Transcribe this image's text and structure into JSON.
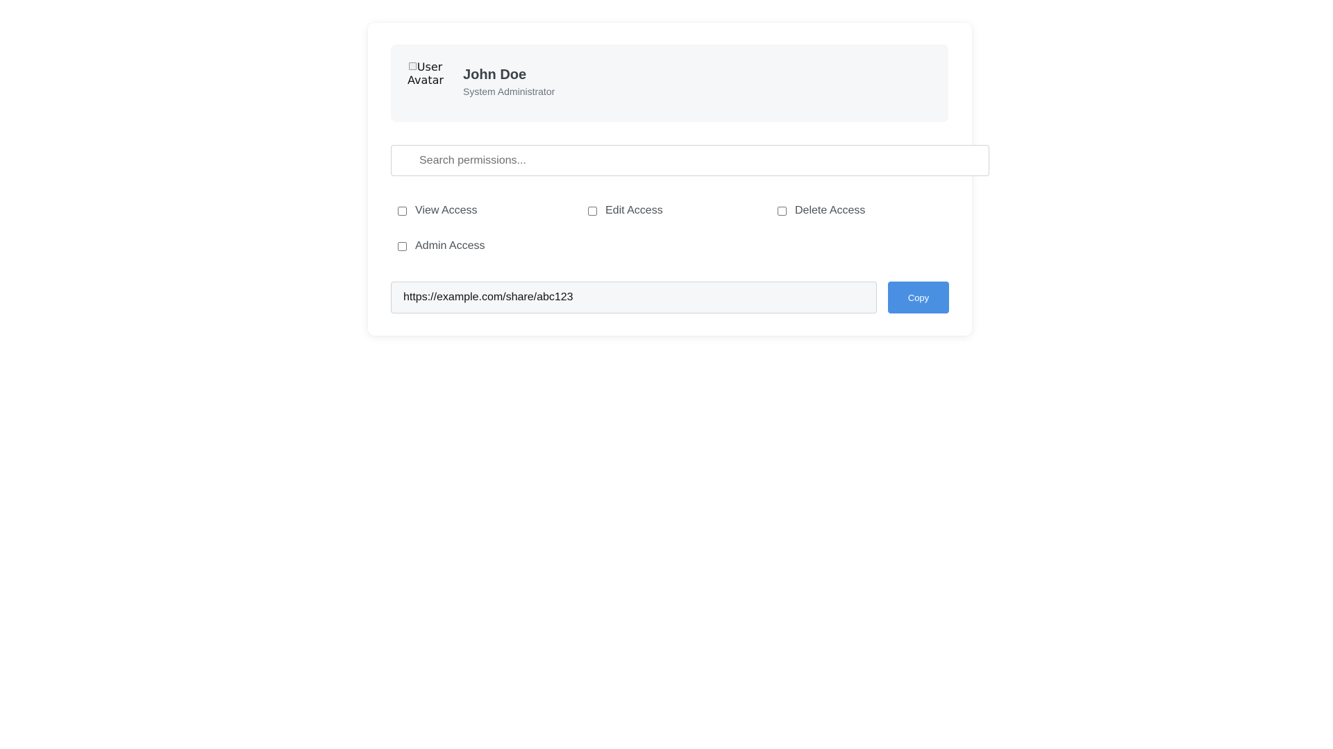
{
  "profile": {
    "avatar_alt": "User Avatar",
    "name": "John Doe",
    "role": "System Administrator"
  },
  "search": {
    "placeholder": "Search permissions...",
    "value": ""
  },
  "permissions": [
    {
      "label": "View Access",
      "checked": false
    },
    {
      "label": "Edit Access",
      "checked": false
    },
    {
      "label": "Delete Access",
      "checked": false
    },
    {
      "label": "Admin Access",
      "checked": false
    }
  ],
  "share": {
    "url": "https://example.com/share/abc123",
    "copy_label": "Copy"
  },
  "colors": {
    "accent": "#4a90e2",
    "profile_bg": "#f6f7f8",
    "text_dark": "#3a4149",
    "text_muted": "#6c7580"
  },
  "icons": {
    "avatar": "broken-image-icon",
    "search": "search-icon"
  }
}
